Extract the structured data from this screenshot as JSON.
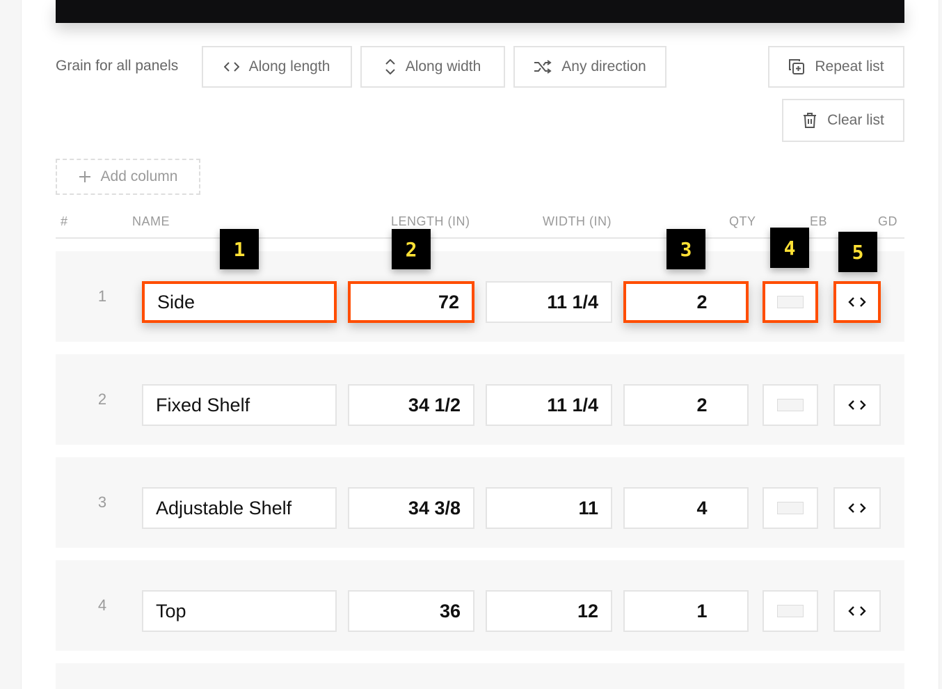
{
  "grain": {
    "label": "Grain for all panels",
    "options": [
      "Along length",
      "Along width",
      "Any direction"
    ]
  },
  "actions": {
    "repeat_list": "Repeat list",
    "clear_list": "Clear list",
    "add_column": "Add column"
  },
  "table": {
    "headers": {
      "num": "#",
      "name": "NAME",
      "length": "LENGTH (IN)",
      "width": "WIDTH (IN)",
      "qty": "QTY",
      "eb": "EB",
      "gd": "GD"
    },
    "rows": [
      {
        "num": "1",
        "name": "Side",
        "length": "72",
        "width": "11 1/4",
        "qty": "2"
      },
      {
        "num": "2",
        "name": "Fixed Shelf",
        "length": "34 1/2",
        "width": "11 1/4",
        "qty": "2"
      },
      {
        "num": "3",
        "name": "Adjustable Shelf",
        "length": "34 3/8",
        "width": "11",
        "qty": "4"
      },
      {
        "num": "4",
        "name": "Top",
        "length": "36",
        "width": "12",
        "qty": "1"
      }
    ]
  },
  "markers": [
    "1",
    "2",
    "3",
    "4",
    "5"
  ],
  "colors": {
    "highlight": "#ff4d00",
    "marker_bg": "#000000",
    "marker_text": "#ffe135",
    "topbar": "#0e0e10"
  }
}
